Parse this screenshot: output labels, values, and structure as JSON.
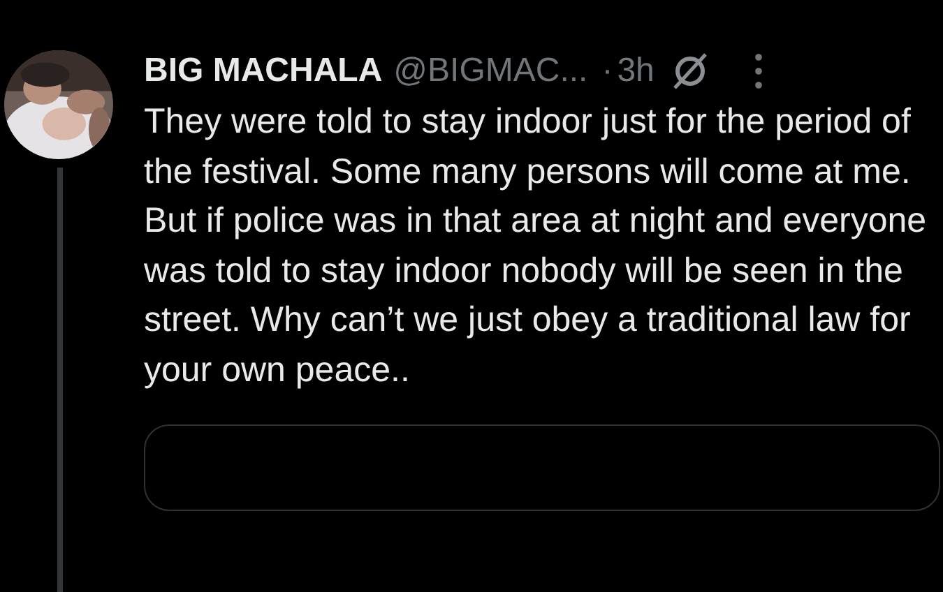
{
  "post": {
    "author_name": "BIG MACHALA",
    "handle": "@BIGMAC...",
    "separator": "·",
    "time": "3h",
    "text": "They were told to stay indoor just for the period of the festival. Some many persons will come at me. But if police was in that area at night and everyone was told to stay indoor nobody will be seen in the street. Why can’t we just obey a traditional law for your own peace.."
  }
}
